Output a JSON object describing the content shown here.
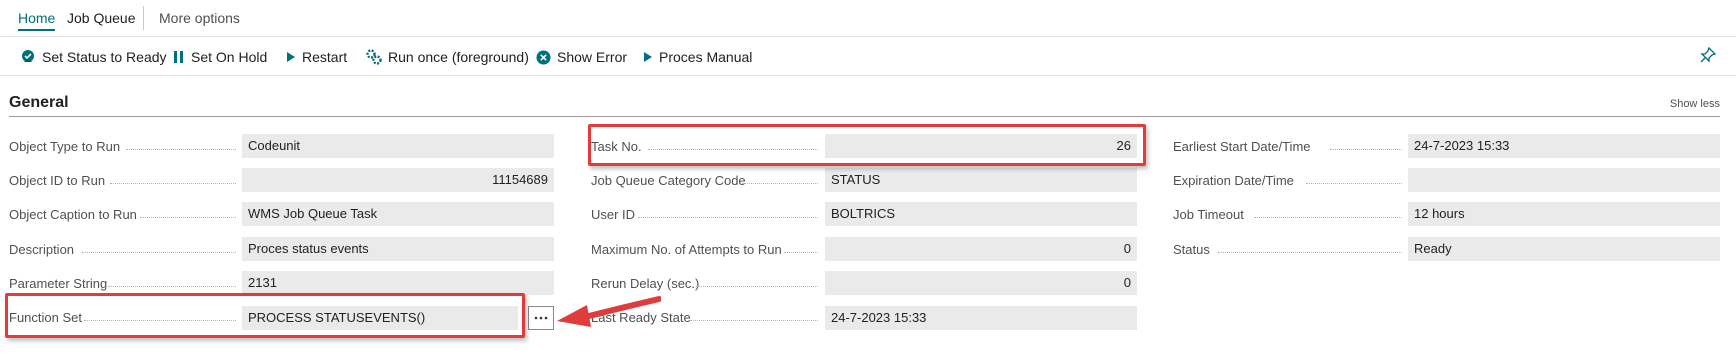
{
  "tabs": [
    {
      "label": "Home"
    },
    {
      "label": "Job Queue"
    },
    {
      "label": "More options"
    }
  ],
  "actions": [
    {
      "label": "Set Status to Ready",
      "icon": "status-ready-icon"
    },
    {
      "label": "Set On Hold",
      "icon": "pause-icon"
    },
    {
      "label": "Restart",
      "icon": "play-icon"
    },
    {
      "label": "Run once (foreground)",
      "icon": "run-gears-icon"
    },
    {
      "label": "Show Error",
      "icon": "error-circle-icon"
    },
    {
      "label": "Proces Manual",
      "icon": "play-icon"
    }
  ],
  "section": {
    "title": "General",
    "show_less": "Show less"
  },
  "fields": {
    "col1": [
      {
        "label": "Object Type to Run",
        "value": "Codeunit"
      },
      {
        "label": "Object ID to Run",
        "value": "11154689"
      },
      {
        "label": "Object Caption to Run",
        "value": "WMS Job Queue Task"
      },
      {
        "label": "Description",
        "value": "Proces status events"
      },
      {
        "label": "Parameter String",
        "value": "2131"
      },
      {
        "label": "Function Set",
        "value": "PROCESS STATUSEVENTS()"
      }
    ],
    "col2": [
      {
        "label": "Task No.",
        "value": "26"
      },
      {
        "label": "Job Queue Category Code",
        "value": "STATUS"
      },
      {
        "label": "User ID",
        "value": "BOLTRICS"
      },
      {
        "label": "Maximum No. of Attempts to Run",
        "value": "0"
      },
      {
        "label": "Rerun Delay (sec.)",
        "value": "0"
      },
      {
        "label": "Last Ready State",
        "value": "24-7-2023 15:33"
      }
    ],
    "col3": [
      {
        "label": "Earliest Start Date/Time",
        "value": "24-7-2023 15:33"
      },
      {
        "label": "Expiration Date/Time",
        "value": ""
      },
      {
        "label": "Job Timeout",
        "value": "12 hours"
      },
      {
        "label": "Status",
        "value": "Ready"
      }
    ]
  },
  "colors": {
    "accent": "#00707a",
    "highlight": "#e03c3c",
    "field_bg": "#eaeaea"
  }
}
